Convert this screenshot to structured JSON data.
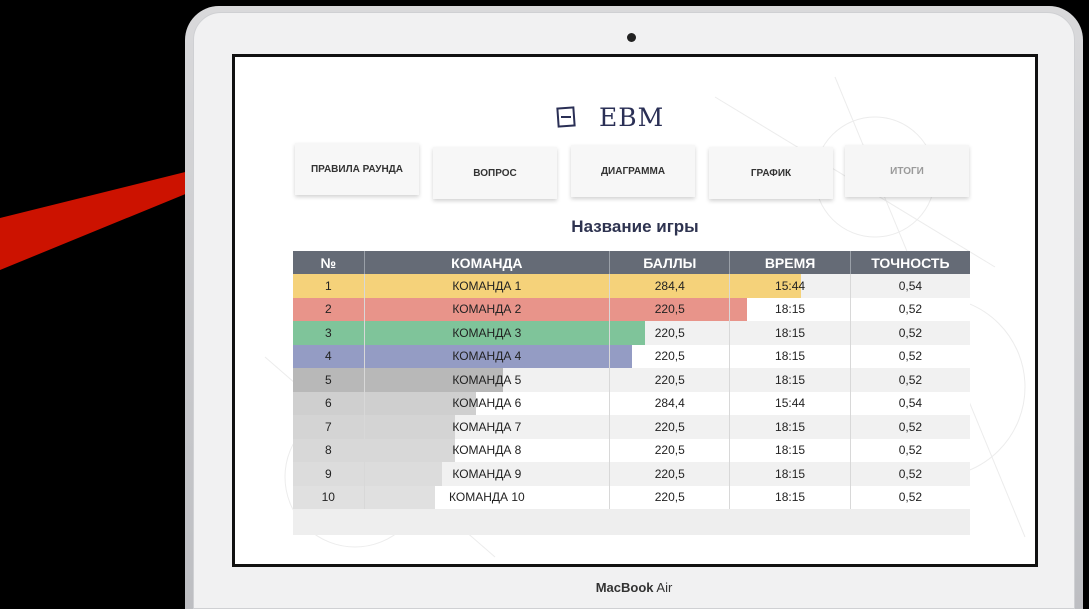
{
  "device": {
    "brand": "MacBook",
    "model": "Air"
  },
  "app": {
    "logo_text": "EBM"
  },
  "nav": [
    {
      "label": "ПРАВИЛА РАУНДА",
      "disabled": false
    },
    {
      "label": "ВОПРОС",
      "disabled": false
    },
    {
      "label": "ДИАГРАММА",
      "disabled": false
    },
    {
      "label": "ГРАФИК",
      "disabled": false
    },
    {
      "label": "ИТОГИ",
      "disabled": true
    }
  ],
  "game_title": "Название игры",
  "table": {
    "headers": [
      "№",
      "КОМАНДА",
      "БАЛЛЫ",
      "ВРЕМЯ",
      "ТОЧНОСТЬ"
    ],
    "rows": [
      {
        "n": "1",
        "team": "КОМАНДА 1",
        "score": "284,4",
        "time": "15:44",
        "acc": "0,54"
      },
      {
        "n": "2",
        "team": "КОМАНДА 2",
        "score": "220,5",
        "time": "18:15",
        "acc": "0,52"
      },
      {
        "n": "3",
        "team": "КОМАНДА 3",
        "score": "220,5",
        "time": "18:15",
        "acc": "0,52"
      },
      {
        "n": "4",
        "team": "КОМАНДА 4",
        "score": "220,5",
        "time": "18:15",
        "acc": "0,52"
      },
      {
        "n": "5",
        "team": "КОМАНДА 5",
        "score": "220,5",
        "time": "18:15",
        "acc": "0,52"
      },
      {
        "n": "6",
        "team": "КОМАНДА 6",
        "score": "284,4",
        "time": "15:44",
        "acc": "0,54"
      },
      {
        "n": "7",
        "team": "КОМАНДА 7",
        "score": "220,5",
        "time": "18:15",
        "acc": "0,52"
      },
      {
        "n": "8",
        "team": "КОМАНДА 8",
        "score": "220,5",
        "time": "18:15",
        "acc": "0,52"
      },
      {
        "n": "9",
        "team": "КОМАНДА 9",
        "score": "220,5",
        "time": "18:15",
        "acc": "0,52"
      },
      {
        "n": "10",
        "team": "КОМАНДА 10",
        "score": "220,5",
        "time": "18:15",
        "acc": "0,52"
      }
    ],
    "row_bar_colors": [
      "#f5d27a",
      "#e8948a",
      "#7fc49a",
      "#949cc4",
      "#b8b8b8",
      "#cfcfcf",
      "#d4d4d4",
      "#d8d8d8",
      "#dcdcdc",
      "#e0e0e0"
    ],
    "row_bar_fill": [
      0.75,
      0.67,
      0.52,
      0.5,
      0.31,
      0.27,
      0.24,
      0.24,
      0.22,
      0.21
    ]
  },
  "colors": {
    "pointer": "#cc1200",
    "header_bg": "#656b76",
    "title": "#2e3350"
  }
}
